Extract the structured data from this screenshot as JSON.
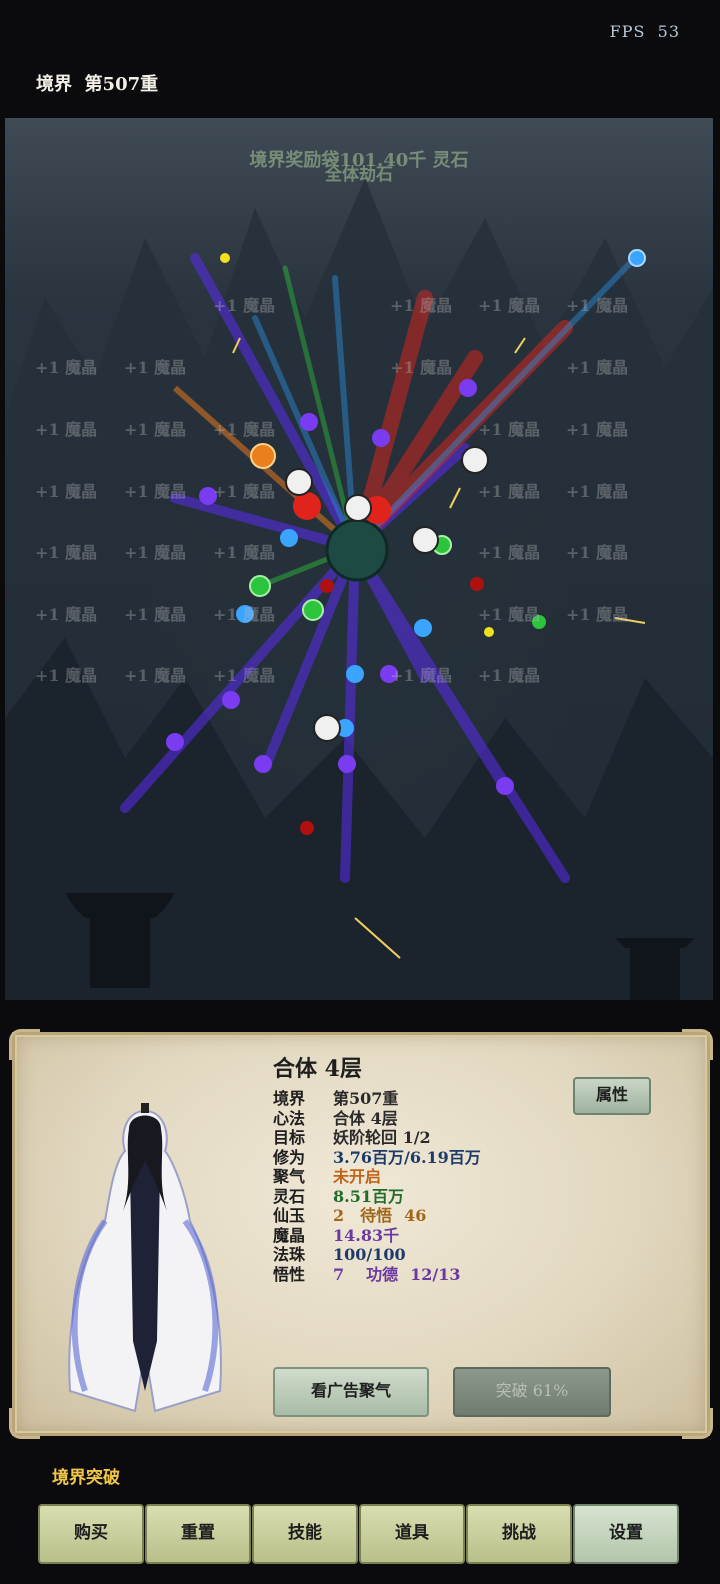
{
  "hud": {
    "fps_label": "FPS",
    "fps_value": "53",
    "realm_label": "境界",
    "realm_value": "第507重"
  },
  "battlefield": {
    "banner_line1": "境界奖励袋101.40千 灵石",
    "banner_line2": "全体劫石",
    "floating_text": "+1 魔晶"
  },
  "character": {
    "title": "合体 4层",
    "attr_button": "属性",
    "stats": [
      {
        "key": "境界",
        "value": "第507重"
      },
      {
        "key": "心法",
        "value": "合体 4层"
      },
      {
        "key": "目标",
        "value": "妖阶轮回 1/2"
      },
      {
        "key": "修为",
        "value": "3.76百万/6.19百万"
      },
      {
        "key": "聚气",
        "value": "未开启"
      },
      {
        "key": "灵石",
        "value": "8.51百万"
      },
      {
        "key": "仙玉",
        "value": "2",
        "extra_key": "待悟",
        "extra_value": "46"
      },
      {
        "key": "魔晶",
        "value": "14.83千"
      },
      {
        "key": "法珠",
        "value": "100/100"
      },
      {
        "key": "悟性",
        "value": "7",
        "extra_key": "功德",
        "extra_value": "12/13"
      }
    ],
    "ad_button": "看广告聚气",
    "breakthrough_button": "突破 61%"
  },
  "section_label": "境界突破",
  "tabs": [
    "购买",
    "重置",
    "技能",
    "道具",
    "挑战",
    "设置"
  ],
  "colors": {
    "accent_gold": "#f1c64b",
    "panel_bg": "#e2d8c0",
    "tab_bg": "#c8ce9c"
  }
}
